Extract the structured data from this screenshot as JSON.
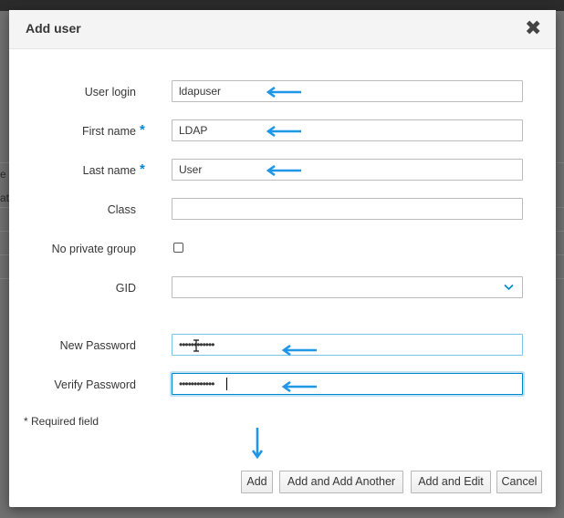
{
  "background": {
    "fragments": [
      "e",
      "at"
    ]
  },
  "dialog": {
    "title": "Add user",
    "close_glyph": "✖",
    "fields": {
      "user_login": {
        "label": "User login",
        "value": "ldapuser",
        "required": false
      },
      "first_name": {
        "label": "First name",
        "value": "LDAP",
        "required": true
      },
      "last_name": {
        "label": "Last name",
        "value": "User",
        "required": true
      },
      "class": {
        "label": "Class",
        "value": ""
      },
      "no_private_group": {
        "label": "No private group",
        "checked": false
      },
      "gid": {
        "label": "GID",
        "value": ""
      },
      "new_password": {
        "label": "New Password",
        "value": "••••••••••••"
      },
      "verify_password": {
        "label": "Verify Password",
        "value": "••••••••••••"
      }
    },
    "required_mark": "*",
    "required_note": "* Required field",
    "buttons": {
      "add": "Add",
      "add_another": "Add and Add Another",
      "add_edit": "Add and Edit",
      "cancel": "Cancel"
    }
  },
  "annotations": {
    "arrow_color": "#1f96e8",
    "arrow_icon": "left-arrow-icon"
  },
  "colors": {
    "accent": "#0088ce",
    "header_bg": "#f4f4f4"
  }
}
